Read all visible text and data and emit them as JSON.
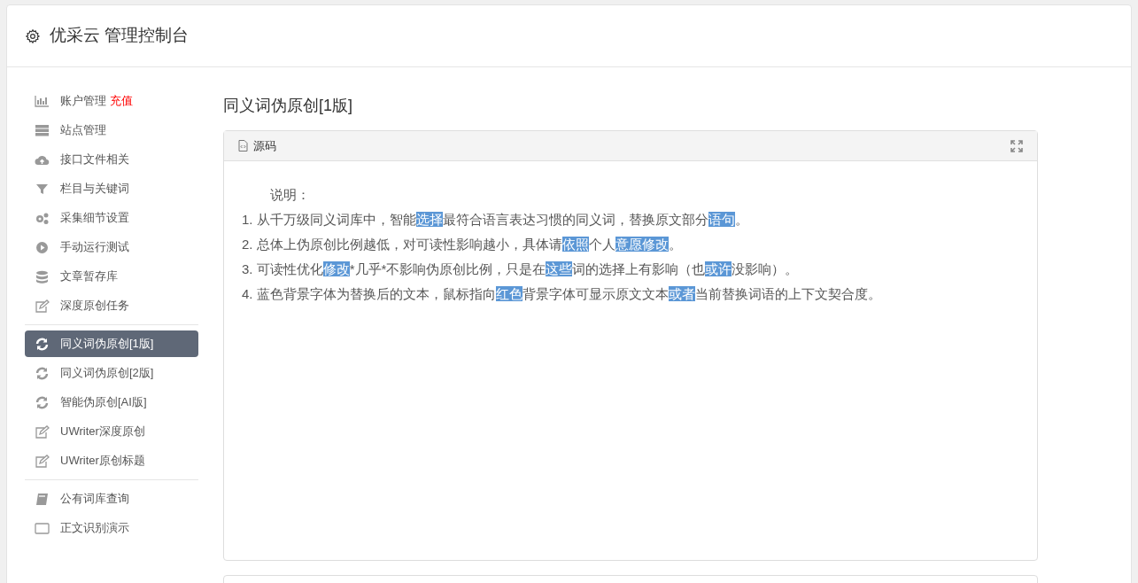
{
  "header": {
    "title": "优采云 管理控制台"
  },
  "sidebar": {
    "groups": [
      [
        {
          "label": "账户管理",
          "badge": "充值",
          "selected": false
        },
        {
          "label": "站点管理",
          "selected": false
        },
        {
          "label": "接口文件相关",
          "selected": false
        },
        {
          "label": "栏目与关键词",
          "selected": false
        },
        {
          "label": "采集细节设置",
          "selected": false
        },
        {
          "label": "手动运行测试",
          "selected": false
        },
        {
          "label": "文章暂存库",
          "selected": false
        },
        {
          "label": "深度原创任务",
          "selected": false
        }
      ],
      [
        {
          "label": "同义词伪原创[1版]",
          "selected": true
        },
        {
          "label": "同义词伪原创[2版]",
          "selected": false
        },
        {
          "label": "智能伪原创[AI版]",
          "selected": false
        },
        {
          "label": "UWriter深度原创",
          "selected": false
        },
        {
          "label": "UWriter原创标题",
          "selected": false
        }
      ],
      [
        {
          "label": "公有词库查询",
          "selected": false
        },
        {
          "label": "正文识别演示",
          "selected": false
        }
      ]
    ]
  },
  "main": {
    "title": "同义词伪原创[1版]",
    "panel": {
      "tab": "源码",
      "heading": "说明：",
      "lines": [
        [
          {
            "text": "1. 从千万级同义词库中，智能",
            "highlighted": false
          },
          {
            "text": "选择",
            "highlighted": true
          },
          {
            "text": "最符合语言表达习惯的同义词，替换原文部分",
            "highlighted": false
          },
          {
            "text": "语句",
            "highlighted": true
          },
          {
            "text": "。",
            "highlighted": false
          }
        ],
        [
          {
            "text": "2. 总体上伪原创比例越低，对可读性影响越小，具体请",
            "highlighted": false
          },
          {
            "text": "依照",
            "highlighted": true
          },
          {
            "text": "个人",
            "highlighted": false
          },
          {
            "text": "意愿",
            "highlighted": true
          },
          {
            "text": "修改",
            "highlighted": true
          },
          {
            "text": "。",
            "highlighted": false
          }
        ],
        [
          {
            "text": "3. 可读性优化",
            "highlighted": false
          },
          {
            "text": "修改",
            "highlighted": true
          },
          {
            "text": "*几乎*不影响伪原创比例，只是在",
            "highlighted": false
          },
          {
            "text": "这些",
            "highlighted": true
          },
          {
            "text": "词的选择上有影响（也",
            "highlighted": false
          },
          {
            "text": "或许",
            "highlighted": true
          },
          {
            "text": "没影响）。",
            "highlighted": false
          }
        ],
        [
          {
            "text": "4. 蓝色背景字体为替换后的文本，鼠标指向",
            "highlighted": false
          },
          {
            "text": "红色",
            "highlighted": true
          },
          {
            "text": "背景字体可显示原文文本",
            "highlighted": false
          },
          {
            "text": "或者",
            "highlighted": true
          },
          {
            "text": "当前替换词语的上下文契合度。",
            "highlighted": false
          }
        ]
      ]
    }
  }
}
